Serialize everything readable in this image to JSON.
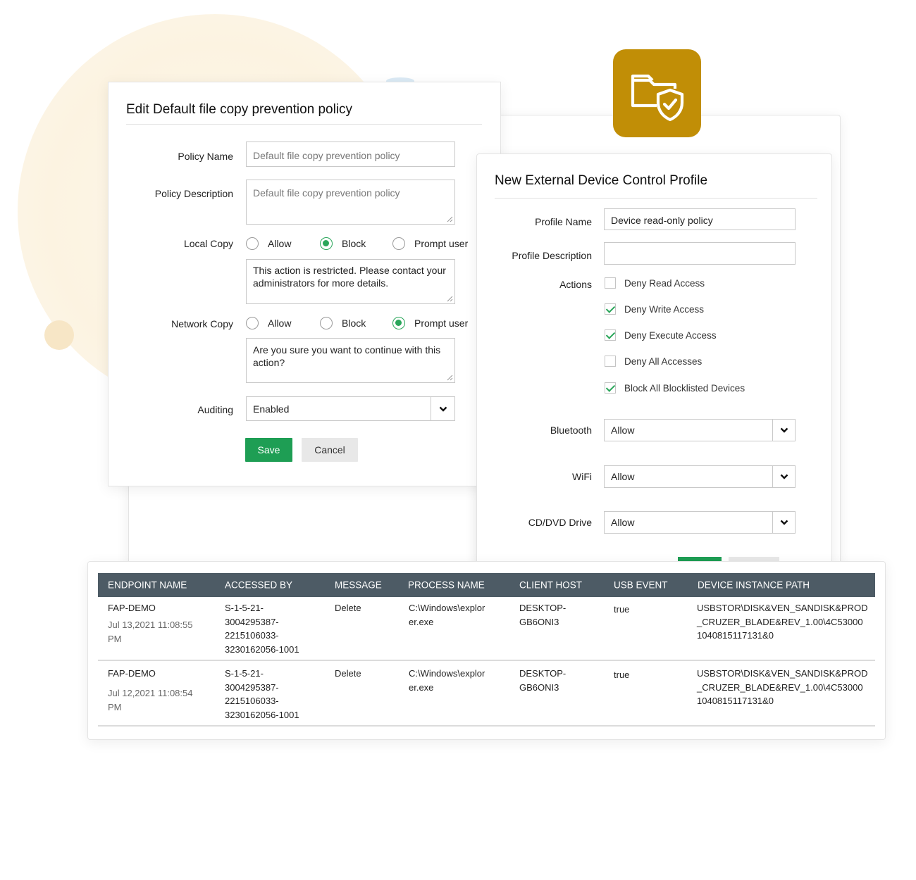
{
  "app_icon": {
    "name": "folder-shield-icon",
    "color": "#c18e06"
  },
  "edit_policy": {
    "title": "Edit Default file copy prevention policy",
    "policy_name_label": "Policy Name",
    "policy_name_placeholder": "Default file copy prevention policy",
    "policy_description_label": "Policy Description",
    "policy_description_placeholder": "Default file copy prevention policy",
    "local_copy": {
      "label": "Local Copy",
      "options": [
        "Allow",
        "Block",
        "Prompt user"
      ],
      "selected": "Block",
      "message": "This action is restricted. Please contact your administrators for more details."
    },
    "network_copy": {
      "label": "Network Copy",
      "options": [
        "Allow",
        "Block",
        "Prompt user"
      ],
      "selected": "Prompt user",
      "message": "Are you sure you want to continue with this action?"
    },
    "auditing_label": "Auditing",
    "auditing_value": "Enabled",
    "save_label": "Save",
    "cancel_label": "Cancel"
  },
  "device_profile": {
    "title": "New External Device Control Profile",
    "profile_name_label": "Profile Name",
    "profile_name_value": "Device read-only policy",
    "profile_description_label": "Profile Description",
    "profile_description_value": "",
    "actions_label": "Actions",
    "actions": [
      {
        "label": "Deny Read Access",
        "checked": false
      },
      {
        "label": "Deny Write Access",
        "checked": true
      },
      {
        "label": "Deny Execute Access",
        "checked": true
      },
      {
        "label": "Deny All Accesses",
        "checked": false
      },
      {
        "label": "Block All Blocklisted Devices",
        "checked": true
      }
    ],
    "bluetooth_label": "Bluetooth",
    "bluetooth_value": "Allow",
    "wifi_label": "WiFi",
    "wifi_value": "Allow",
    "cddvd_label": "CD/DVD Drive",
    "cddvd_value": "Allow"
  },
  "usb_table": {
    "columns": [
      "ENDPOINT NAME",
      "ACCESSED BY",
      "MESSAGE",
      "PROCESS NAME",
      "CLIENT HOST",
      "USB EVENT",
      "DEVICE INSTANCE PATH"
    ],
    "rows": [
      {
        "endpoint": "FAP-DEMO",
        "time": "Jul 13,2021 11:08:55\nPM",
        "accessed_by": "S-1-5-21-\n3004295387-\n2215106033-\n3230162056-1001",
        "message": "Delete",
        "process": "C:\\Windows\\explor\ner.exe",
        "host": "DESKTOP-\nGB6ONI3",
        "usb_event": "true",
        "path": "USBSTOR\\DISK&VEN_SANDISK&PROD\n_CRUZER_BLADE&REV_1.00\\4C53000\n1040815117131&0"
      },
      {
        "endpoint": "FAP-DEMO",
        "time": "Jul 12,2021 11:08:54\nPM",
        "accessed_by": "S-1-5-21-\n3004295387-\n2215106033-\n3230162056-1001",
        "message": "Delete",
        "process": "C:\\Windows\\explor\ner.exe",
        "host": "DESKTOP-\nGB6ONI3",
        "usb_event": "true",
        "path": "USBSTOR\\DISK&VEN_SANDISK&PROD\n_CRUZER_BLADE&REV_1.00\\4C53000\n1040815117131&0"
      }
    ]
  }
}
